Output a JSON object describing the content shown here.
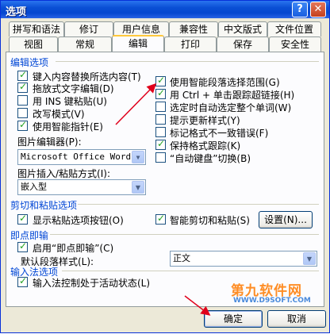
{
  "window": {
    "title": "选项",
    "help_glyph": "?",
    "close_glyph": "✕"
  },
  "tabs_row1": [
    {
      "label": "拼写和语法"
    },
    {
      "label": "修订"
    },
    {
      "label": "用户信息"
    },
    {
      "label": "兼容性"
    },
    {
      "label": "中文版式"
    },
    {
      "label": "文件位置"
    }
  ],
  "tabs_row2": [
    {
      "label": "视图"
    },
    {
      "label": "常规"
    },
    {
      "label": "编辑",
      "active": true
    },
    {
      "label": "打印"
    },
    {
      "label": "保存"
    },
    {
      "label": "安全性"
    }
  ],
  "editing": {
    "group_label": "编辑选项",
    "left_options": [
      {
        "label": "键入内容替换所选内容(T)",
        "checked": true
      },
      {
        "label": "拖放式文字编辑(D)",
        "checked": true
      },
      {
        "label": "用 INS 键粘贴(U)",
        "checked": false
      },
      {
        "label": "改写模式(V)",
        "checked": false
      },
      {
        "label": "使用智能指针(E)",
        "checked": true
      }
    ],
    "right_options": [
      {
        "label": "使用智能段落选择范围(G)",
        "checked": true
      },
      {
        "label": "用 Ctrl + 单击跟踪超链接(H)",
        "checked": true
      },
      {
        "label": "选定时自动选定整个单词(W)",
        "checked": false
      },
      {
        "label": "提示更新样式(Y)",
        "checked": false
      },
      {
        "label": "标记格式不一致错误(F)",
        "checked": false
      },
      {
        "label": "保持格式跟踪(K)",
        "checked": true
      },
      {
        "label": "“自动键盘”切换(B)",
        "checked": false
      }
    ],
    "picture_editor_label": "图片编辑器(P):",
    "picture_editor_value": "Microsoft Office Word",
    "insert_paste_label": "图片插入/粘贴方式(I):",
    "insert_paste_value": "嵌入型"
  },
  "cut_paste": {
    "group_label": "剪切和粘贴选项",
    "show_buttons_label": "显示粘贴选项按钮(O)",
    "show_buttons_checked": true,
    "smart_cut_label": "智能剪切和粘贴(S)",
    "smart_cut_checked": true,
    "settings_button": "设置(N)..."
  },
  "click_type": {
    "group_label": "即点即输",
    "enable_label": "启用“即点即输”(C)",
    "enable_checked": true,
    "default_style_label": "默认段落样式(L):",
    "default_style_value": "正文"
  },
  "ime": {
    "group_label": "输入法选项",
    "control_label": "输入法控制处于活动状态(L)",
    "control_checked": true
  },
  "footer": {
    "ok_label": "确定",
    "cancel_label": "取消"
  },
  "watermark": {
    "line1": "第九软件网",
    "line2": "WWW.D9SOFT.COM"
  },
  "colors": {
    "titlebar": "#0a4fd4",
    "group_label": "#0046d5",
    "annotation": "#e0001b",
    "tab_active_accent": "#ffc83c"
  }
}
